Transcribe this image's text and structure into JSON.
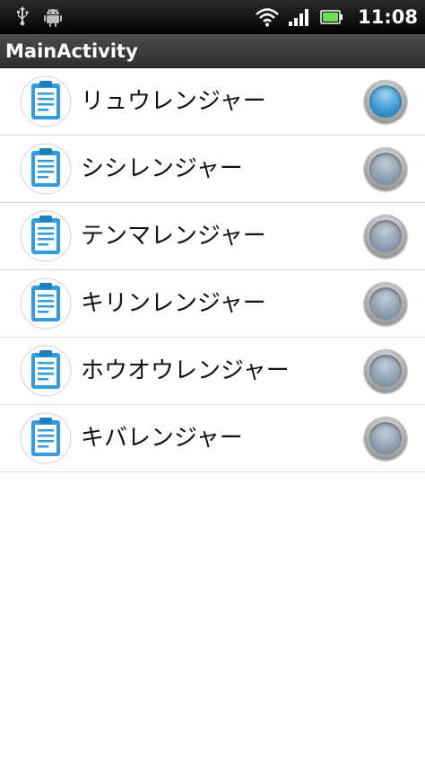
{
  "status_bar": {
    "time": "11:08",
    "icons": [
      "usb-icon",
      "android-debug-icon",
      "wifi-icon",
      "signal-icon",
      "battery-icon"
    ]
  },
  "app": {
    "title": "MainActivity"
  },
  "list": {
    "items": [
      {
        "label": "リュウレンジャー",
        "selected": true
      },
      {
        "label": "シシレンジャー",
        "selected": false
      },
      {
        "label": "テンマレンジャー",
        "selected": false
      },
      {
        "label": "キリンレンジャー",
        "selected": false
      },
      {
        "label": "ホウオウレンジャー",
        "selected": false
      },
      {
        "label": "キバレンジャー",
        "selected": false
      }
    ]
  },
  "colors": {
    "accent": "#3d9ad3",
    "clipboard_blue": "#2f9de0"
  }
}
